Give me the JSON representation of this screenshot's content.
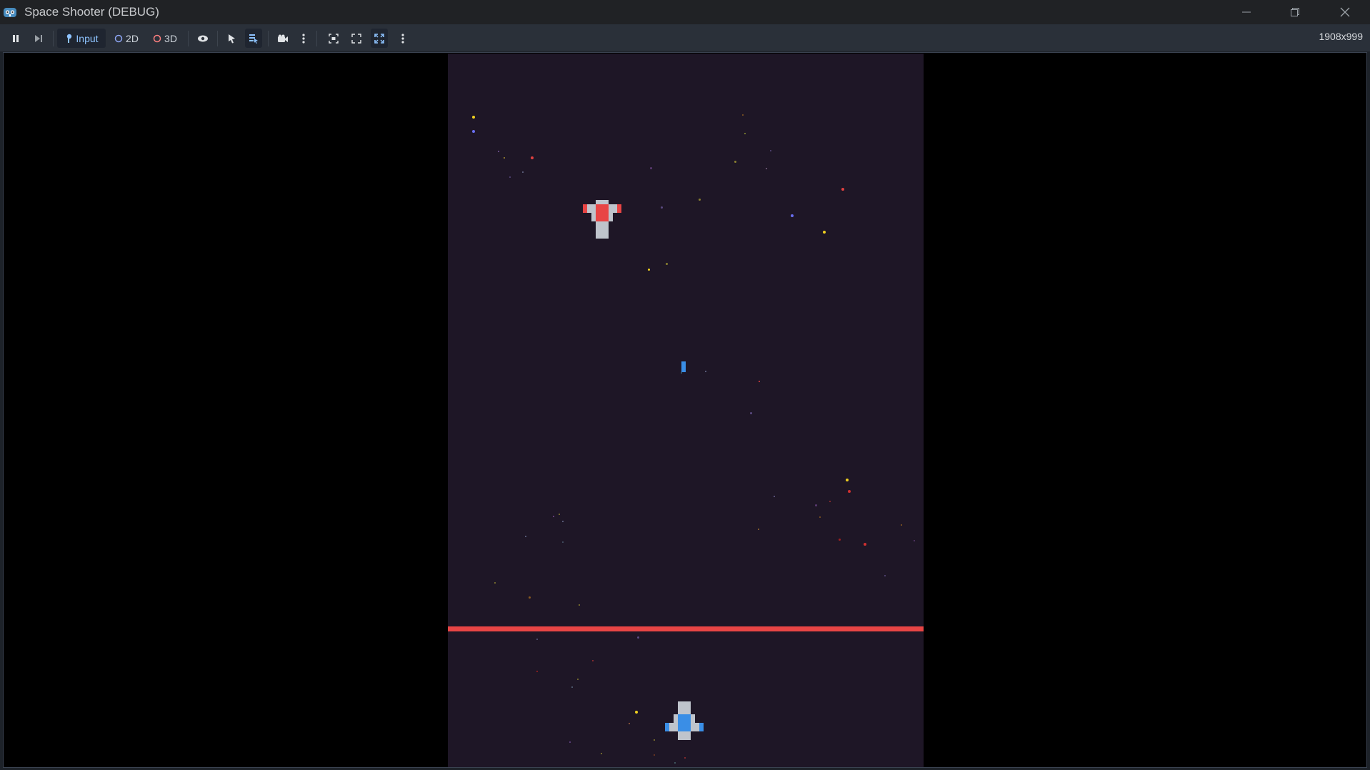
{
  "window": {
    "title": "Space Shooter (DEBUG)",
    "controls": [
      "minimize",
      "restore",
      "close"
    ]
  },
  "toolbar": {
    "pause_icon": "pause-icon",
    "next_frame_icon": "next-frame-icon",
    "input_label": "Input",
    "mode_2d_label": "2D",
    "mode_3d_label": "3D",
    "resolution": "1908x999"
  },
  "colors": {
    "titlebar_bg": "#202225",
    "toolbar_bg": "#2a3039",
    "game_bg": "#1e1626",
    "laser": "#e84545",
    "player_accent": "#3a8ee6",
    "enemy_accent": "#e84545"
  },
  "game": {
    "player_ship": {
      "color": "#3a8ee6",
      "icon": "player-ship"
    },
    "enemy_ship": {
      "color": "#e84545",
      "icon": "enemy-ship"
    },
    "player_bullet": {
      "color": "#3a8ee6"
    },
    "laser_line": {
      "color": "#e84545"
    }
  }
}
